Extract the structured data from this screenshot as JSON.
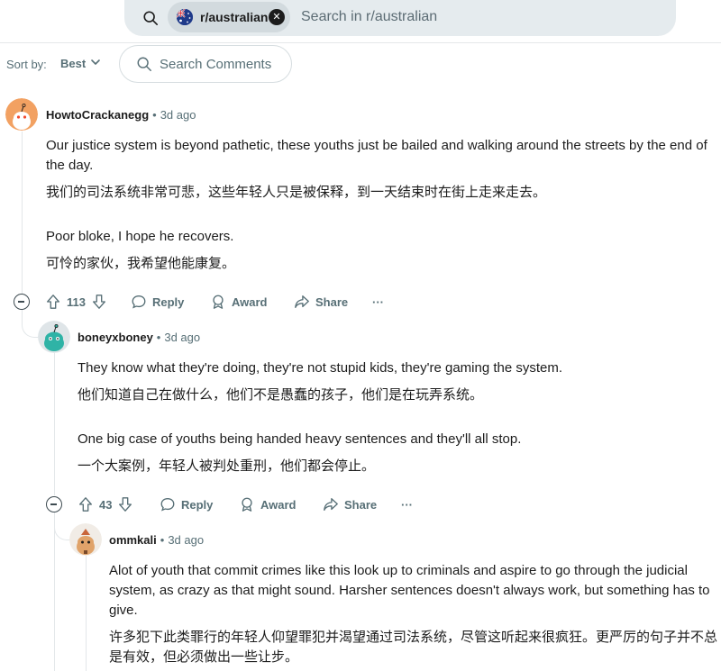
{
  "search": {
    "community": "r/australian",
    "placeholder": "Search in r/australian",
    "clear_glyph": "✕"
  },
  "sort": {
    "label": "Sort by:",
    "value": "Best",
    "search_comments": "Search Comments"
  },
  "actions": {
    "reply": "Reply",
    "award": "Award",
    "share": "Share",
    "more": "···"
  },
  "comments": [
    {
      "user": "HowtoCrackanegg",
      "separator": "•",
      "time": "3d ago",
      "paragraphs": [
        "Our justice system is beyond pathetic, these youths just be bailed and walking around the streets by the end of the day.",
        "我们的司法系统非常可悲，这些年轻人只是被保释，到一天结束时在街上走来走去。",
        "Poor bloke, I hope he recovers.",
        "可怜的家伙，我希望他能康复。"
      ],
      "votes": "113"
    },
    {
      "user": "boneyxboney",
      "separator": "•",
      "time": "3d ago",
      "paragraphs": [
        "They know what they're doing, they're not stupid kids, they're gaming the system.",
        "他们知道自己在做什么，他们不是愚蠢的孩子，他们是在玩弄系统。",
        "One big case of youths being handed heavy sentences and they'll all stop.",
        "一个大案例，年轻人被判处重刑，他们都会停止。"
      ],
      "votes": "43"
    },
    {
      "user": "ommkali",
      "separator": "•",
      "time": "3d ago",
      "paragraphs": [
        "Alot of youth that commit crimes like this look up to criminals and aspire to go through the judicial system, as crazy as that might sound. Harsher sentences doesn't always work, but something has to give.",
        "许多犯下此类罪行的年轻人仰望罪犯并渴望通过司法系统，尽管这听起来很疯狂。更严厉的句子并不总是有效，但必须做出一些让步。"
      ]
    }
  ],
  "icons": {
    "search": "search-icon",
    "flag": "australia-flag-icon",
    "upvote": "upvote-icon",
    "downvote": "downvote-icon",
    "reply": "comment-bubble-icon",
    "award": "award-icon",
    "share": "share-icon",
    "collapse": "collapse-minus-icon"
  },
  "colors": {
    "search_bg": "#e5ebee",
    "chip_bg": "#d2dade",
    "meta_gray": "#576f76",
    "avatar1": "#f2a162",
    "avatar2": "#2fb3a6",
    "avatar3": "#e0a36a"
  }
}
